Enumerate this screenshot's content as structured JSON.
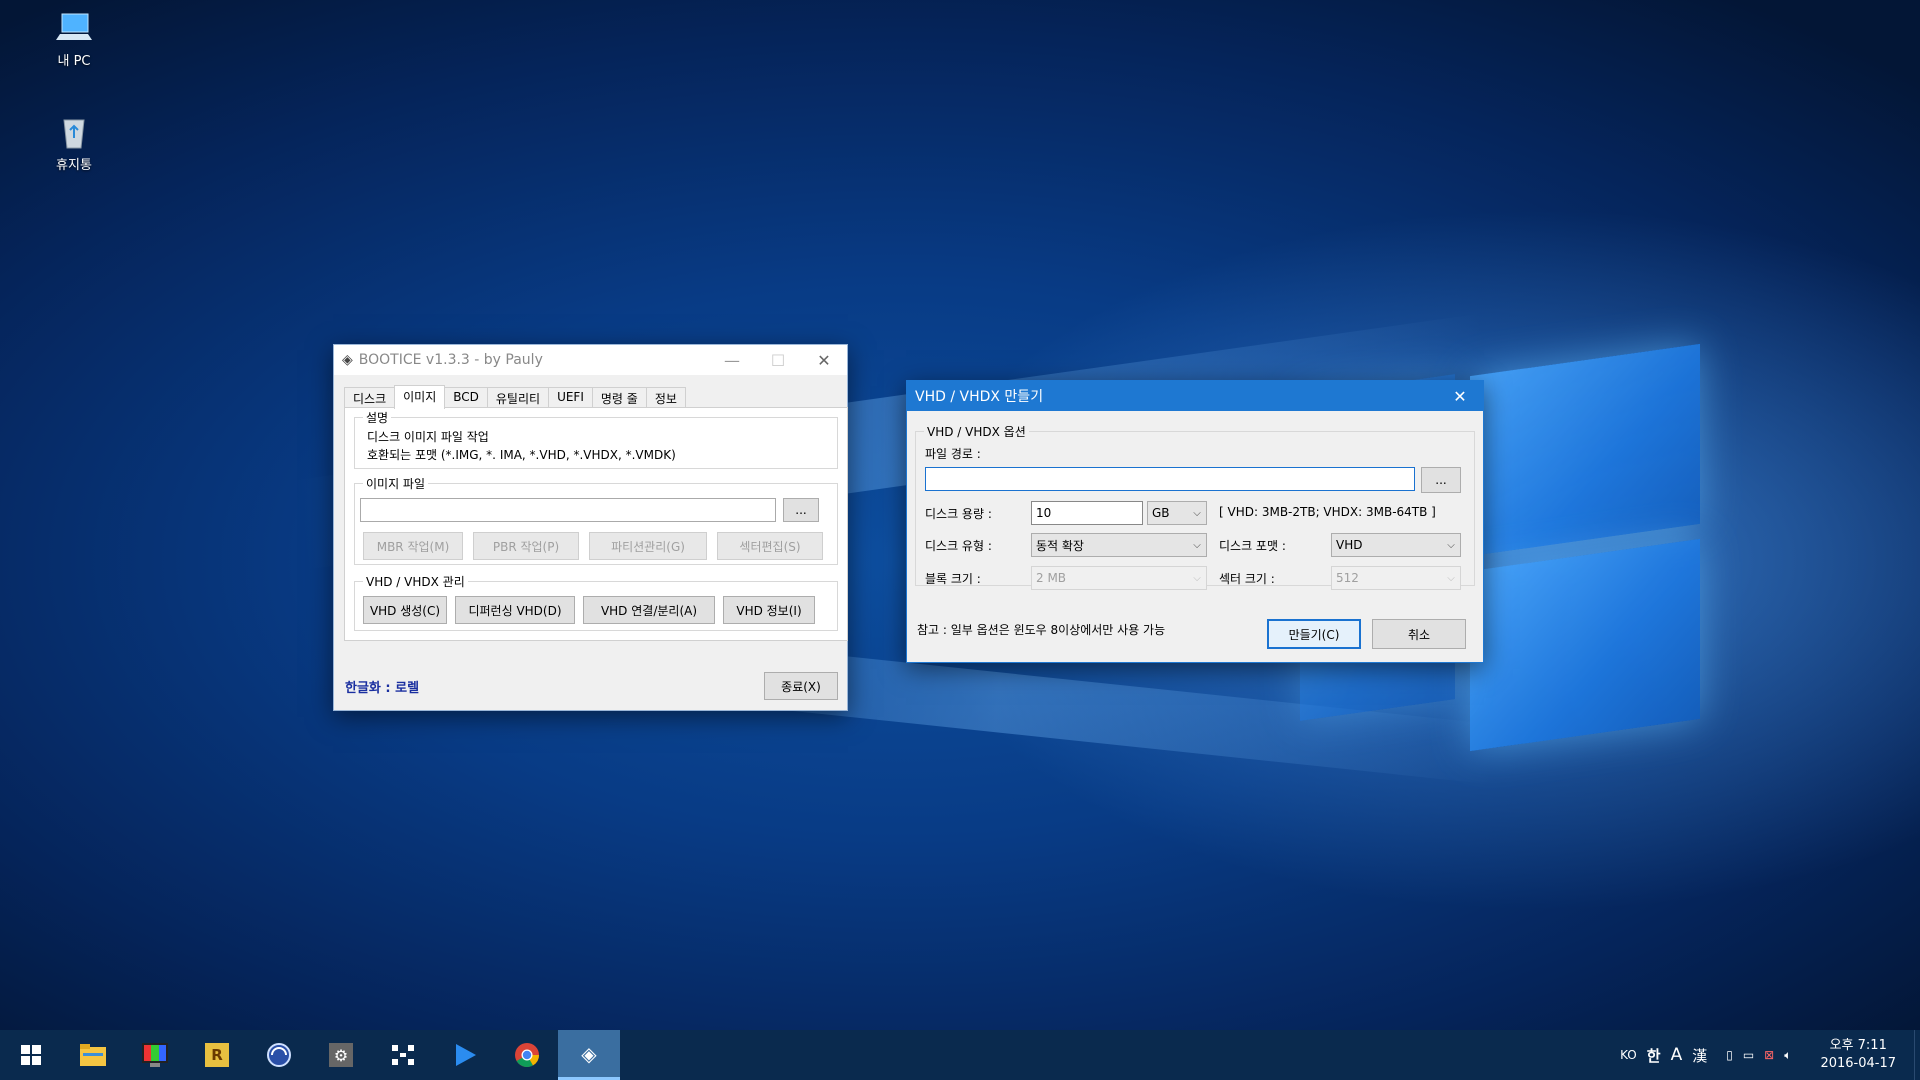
{
  "desktop": {
    "icons": [
      {
        "label": "내 PC",
        "icon": "computer-icon"
      },
      {
        "label": "휴지통",
        "icon": "recycle-bin-icon"
      }
    ]
  },
  "bootice": {
    "title": "BOOTICE v1.3.3 - by Pauly",
    "tabs": [
      "디스크",
      "이미지",
      "BCD",
      "유틸리티",
      "UEFI",
      "명령 줄",
      "정보"
    ],
    "active_tab": "이미지",
    "desc_group": "설명",
    "desc_line1": "디스크 이미지 파일 작업",
    "desc_line2": "호환되는 포맷 (*.IMG, *. IMA, *.VHD, *.VHDX, *.VMDK)",
    "image_group": "이미지 파일",
    "image_value": "",
    "browse": "...",
    "mbr": "MBR 작업(M)",
    "pbr": "PBR 작업(P)",
    "partition": "파티션관리(G)",
    "sector": "섹터편집(S)",
    "vhd_group": "VHD / VHDX 관리",
    "vhd_create": "VHD 생성(C)",
    "vhd_diff": "디퍼런싱 VHD(D)",
    "vhd_attach": "VHD 연결/분리(A)",
    "vhd_info": "VHD 정보(I)",
    "localize": "한글화 : 로렐",
    "exit": "종료(X)"
  },
  "vhd_dialog": {
    "title": "VHD / VHDX 만들기",
    "options_group": "VHD / VHDX 옵션",
    "path_label": "파일 경로 :",
    "path_value": "",
    "browse": "...",
    "size_label": "디스크 용량 :",
    "size_value": "10",
    "size_unit": "GB",
    "size_hint": "[ VHD: 3MB-2TB; VHDX: 3MB-64TB ]",
    "type_label": "디스크 유형 :",
    "type_value": "동적 확장",
    "format_label": "디스크 포맷 :",
    "format_value": "VHD",
    "block_label": "블록 크기 :",
    "block_value": "2 MB",
    "sector_label": "섹터 크기 :",
    "sector_value": "512",
    "note": "참고 : 일부 옵션은 윈도우 8이상에서만 사용 가능",
    "create": "만들기(C)",
    "cancel": "취소"
  },
  "taskbar": {
    "apps": [
      "file-explorer-icon",
      "color-app-icon",
      "r-app-icon",
      "globe-app-icon",
      "settings-app-icon",
      "grid-app-icon",
      "play-live-icon",
      "chrome-icon",
      "bootice-icon"
    ],
    "tray": {
      "lang": "KO",
      "ime1": "한",
      "ime2": "A",
      "ime3": "漢",
      "time": "오후 7:11",
      "date": "2016-04-17"
    }
  },
  "colors": {
    "accent": "#1e78d2",
    "taskbar": "#0a2a4e",
    "link_blue": "#1a2fa0"
  }
}
